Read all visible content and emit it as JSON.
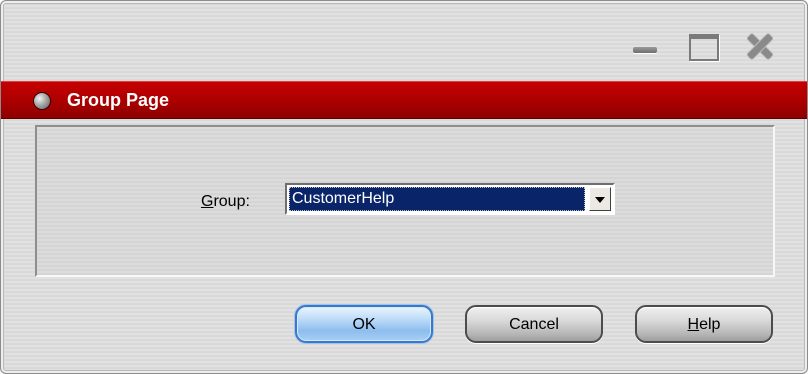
{
  "window": {
    "controls": {
      "minimize_icon": "minimize-icon",
      "maximize_icon": "maximize-icon",
      "close_icon": "close-icon"
    }
  },
  "header": {
    "title": "Group Page",
    "color": "#b00000"
  },
  "form": {
    "group_label_mnemonic": "G",
    "group_label_rest": "roup:",
    "group_value": "CustomerHelp"
  },
  "buttons": {
    "ok_label": "OK",
    "cancel_label": "Cancel",
    "help_mnemonic": "H",
    "help_rest": "elp"
  },
  "colors": {
    "selection": "#0a246a",
    "ok_accent": "#3a78c8"
  }
}
